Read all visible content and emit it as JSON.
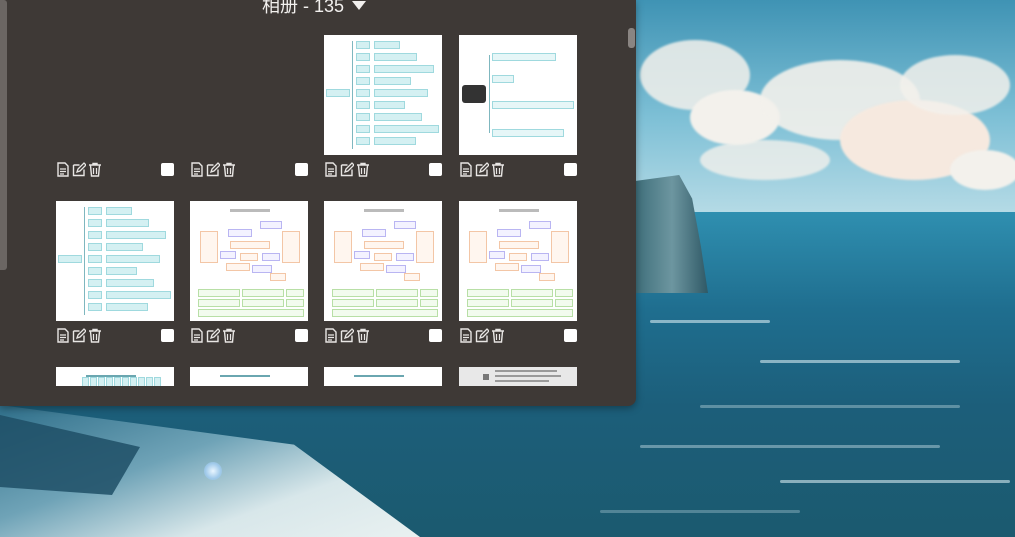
{
  "album": {
    "title": "相册 - 135"
  },
  "tiles": [
    {
      "kind": "empty"
    },
    {
      "kind": "empty"
    },
    {
      "kind": "mindmap-list"
    },
    {
      "kind": "mindmap-dark"
    },
    {
      "kind": "mindmap-list"
    },
    {
      "kind": "org-chart"
    },
    {
      "kind": "org-chart"
    },
    {
      "kind": "org-chart"
    },
    {
      "kind": "partial"
    },
    {
      "kind": "partial"
    },
    {
      "kind": "partial"
    },
    {
      "kind": "partial-text"
    }
  ],
  "icons": [
    "document-icon",
    "edit-icon",
    "trash-icon"
  ],
  "colors": {
    "panel_bg": "#3e3936",
    "title_text": "#f2f0ee",
    "checkbox": "#ffffff"
  }
}
